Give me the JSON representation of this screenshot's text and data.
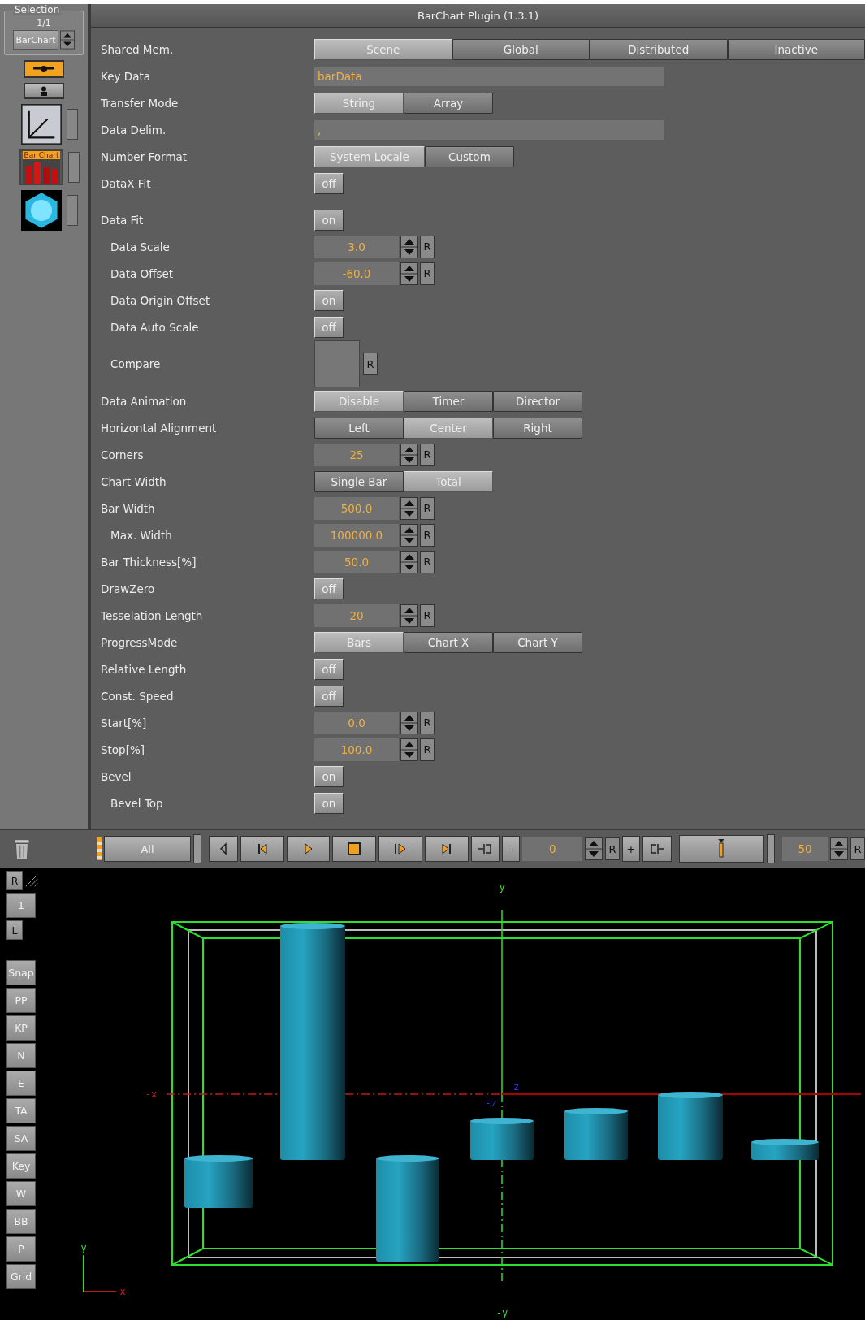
{
  "window": {
    "title": "BarChart Plugin (1.3.1)"
  },
  "selection": {
    "legend": "Selection",
    "count": "1/1",
    "object": "BarChart",
    "thumbnail_caption": "Bar Chart"
  },
  "properties": [
    {
      "kind": "segmented",
      "label": "Shared Mem.",
      "options": [
        {
          "label": "Scene",
          "selected": true
        },
        {
          "label": "Global",
          "selected": false
        },
        {
          "label": "Distributed",
          "selected": false
        },
        {
          "label": "Inactive",
          "selected": false
        }
      ]
    },
    {
      "kind": "text_field",
      "label": "Key Data",
      "value": "barData"
    },
    {
      "kind": "segmented",
      "label": "Transfer Mode",
      "options": [
        {
          "label": "String",
          "selected": true
        },
        {
          "label": "Array",
          "selected": false
        }
      ]
    },
    {
      "kind": "text_field",
      "label": "Data Delim.",
      "value": ","
    },
    {
      "kind": "segmented",
      "label": "Number Format",
      "options": [
        {
          "label": "System Locale",
          "selected": true
        },
        {
          "label": "Custom",
          "selected": false
        }
      ]
    },
    {
      "kind": "toggle",
      "label": "DataX Fit",
      "value": "off"
    },
    {
      "kind": "toggle",
      "label": "Data Fit",
      "value": "on",
      "children": [
        {
          "kind": "spinner",
          "label": "Data Scale",
          "value": "3.0",
          "reset": "R"
        },
        {
          "kind": "spinner",
          "label": "Data Offset",
          "value": "-60.0",
          "reset": "R"
        },
        {
          "kind": "toggle",
          "label": "Data Origin Offset",
          "value": "on"
        },
        {
          "kind": "toggle",
          "label": "Data Auto Scale",
          "value": "off"
        },
        {
          "kind": "swatch",
          "label": "Compare",
          "reset": "R"
        }
      ]
    },
    {
      "kind": "segmented",
      "label": "Data Animation",
      "options": [
        {
          "label": "Disable",
          "selected": true
        },
        {
          "label": "Timer",
          "selected": false
        },
        {
          "label": "Director",
          "selected": false
        }
      ]
    },
    {
      "kind": "segmented",
      "label": "Horizontal Alignment",
      "options": [
        {
          "label": "Left",
          "selected": false
        },
        {
          "label": "Center",
          "selected": true
        },
        {
          "label": "Right",
          "selected": false
        }
      ]
    },
    {
      "kind": "spinner",
      "label": "Corners",
      "value": "25",
      "reset": "R"
    },
    {
      "kind": "segmented",
      "label": "Chart Width",
      "options": [
        {
          "label": "Single Bar",
          "selected": false
        },
        {
          "label": "Total",
          "selected": true
        }
      ]
    },
    {
      "kind": "spinner",
      "label": "Bar Width",
      "value": "500.0",
      "reset": "R",
      "children": [
        {
          "kind": "spinner",
          "label": "Max. Width",
          "value": "100000.0",
          "reset": "R"
        }
      ]
    },
    {
      "kind": "spinner",
      "label": "Bar Thickness[%]",
      "value": "50.0",
      "reset": "R"
    },
    {
      "kind": "toggle",
      "label": "DrawZero",
      "value": "off"
    },
    {
      "kind": "spinner",
      "label": "Tesselation Length",
      "value": "20",
      "reset": "R"
    },
    {
      "kind": "segmented",
      "label": "ProgressMode",
      "options": [
        {
          "label": "Bars",
          "selected": true
        },
        {
          "label": "Chart X",
          "selected": false
        },
        {
          "label": "Chart Y",
          "selected": false
        }
      ]
    },
    {
      "kind": "toggle",
      "label": "Relative Length",
      "value": "off"
    },
    {
      "kind": "toggle",
      "label": "Const. Speed",
      "value": "off"
    },
    {
      "kind": "spinner",
      "label": "Start[%]",
      "value": "0.0",
      "reset": "R"
    },
    {
      "kind": "spinner",
      "label": "Stop[%]",
      "value": "100.0",
      "reset": "R"
    },
    {
      "kind": "toggle",
      "label": "Bevel",
      "value": "on",
      "children": [
        {
          "kind": "toggle",
          "label": "Bevel Top",
          "value": "on"
        }
      ]
    }
  ],
  "transport": {
    "all_button": "All",
    "minus": "-",
    "frame": "0",
    "frame_reset": "R",
    "plus": "+",
    "slider": {
      "level": 0.5
    },
    "end_frame": "50",
    "end_reset": "R"
  },
  "viewport": {
    "tools": [
      "R",
      "1",
      "L",
      "Snap",
      "PP",
      "KP",
      "N",
      "E",
      "TA",
      "SA",
      "Key",
      "W",
      "BB",
      "P",
      "Grid"
    ],
    "axis_labels": {
      "y": "y",
      "neg_y": "-y",
      "neg_x": "-x",
      "z": "z",
      "neg_z": "-z"
    },
    "gizmo_labels": {
      "y": "y",
      "x": "x"
    }
  }
}
